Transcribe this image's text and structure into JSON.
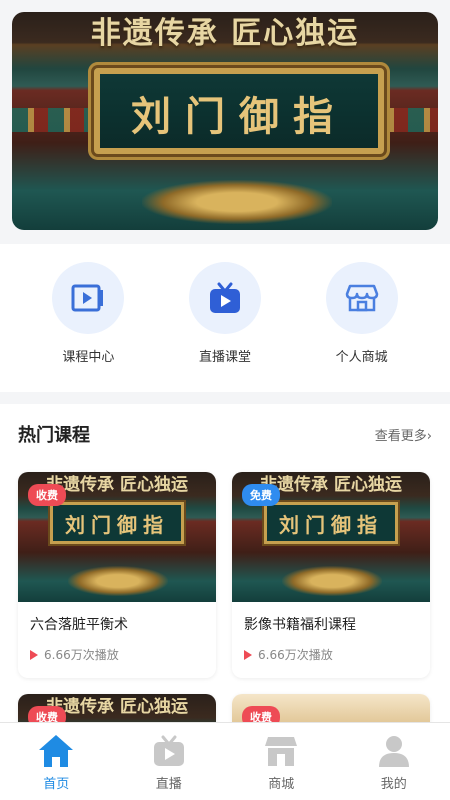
{
  "banner": {
    "slogan": "非遗传承 匠心独运",
    "plaque": "刘门御指"
  },
  "shortcuts": [
    {
      "label": "课程中心",
      "icon": "course-center-icon"
    },
    {
      "label": "直播课堂",
      "icon": "live-tv-icon"
    },
    {
      "label": "个人商城",
      "icon": "shop-icon"
    }
  ],
  "hot": {
    "title": "热门课程",
    "more": "查看更多›",
    "courses": [
      {
        "badge": "收费",
        "badge_type": "paid",
        "title": "六合落脏平衡术",
        "plays": "6.66万次播放"
      },
      {
        "badge": "免费",
        "badge_type": "free",
        "title": "影像书籍福利课程",
        "plays": "6.66万次播放"
      },
      {
        "badge": "收费",
        "badge_type": "paid",
        "title": "",
        "plays": ""
      },
      {
        "badge": "收费",
        "badge_type": "paid",
        "title": "",
        "plays": ""
      }
    ]
  },
  "tabbar": [
    {
      "label": "首页",
      "active": true
    },
    {
      "label": "直播",
      "active": false
    },
    {
      "label": "商城",
      "active": false
    },
    {
      "label": "我的",
      "active": false
    }
  ],
  "colors": {
    "accent": "#1f8be3",
    "paid": "#ee4b55",
    "free": "#2f8cf0",
    "icon_bg": "#eaf1fd"
  }
}
